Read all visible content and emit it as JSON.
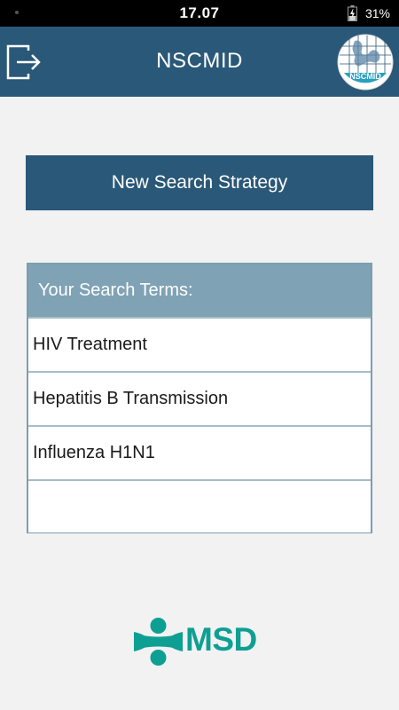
{
  "status_bar": {
    "time": "17.07",
    "battery": "31%"
  },
  "header": {
    "title": "NSCMID",
    "exit_icon": "exit-icon",
    "logo_text": "NSCMID"
  },
  "actions": {
    "new_search_label": "New Search Strategy"
  },
  "search_terms": {
    "heading": "Your Search Terms:",
    "items": [
      "HIV Treatment",
      "Hepatitis B Transmission",
      "Influenza H1N1",
      ""
    ]
  },
  "footer": {
    "brand": "MSD"
  },
  "colors": {
    "header_bg": "#2a5878",
    "panel_header_bg": "#7fa2b5",
    "page_bg": "#f2f2f2",
    "brand_teal": "#0e9f93"
  }
}
